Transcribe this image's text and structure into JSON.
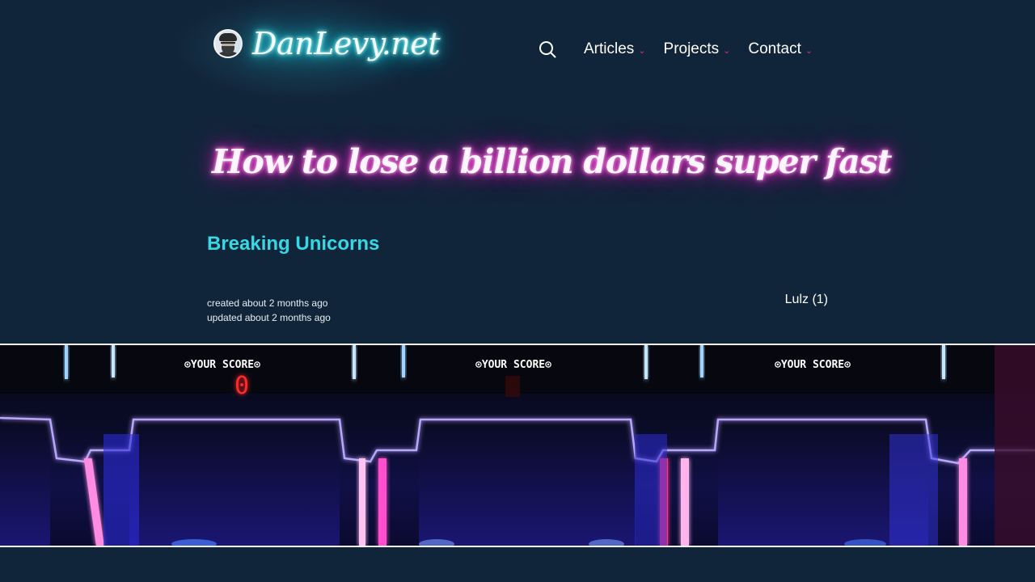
{
  "site": {
    "name": "DanLevy.net"
  },
  "nav": {
    "items": [
      {
        "label": "Articles"
      },
      {
        "label": "Projects"
      },
      {
        "label": "Contact"
      }
    ],
    "chevron": "⌄"
  },
  "article": {
    "title": "How to lose a billion dollars super fast",
    "subtitle": "Breaking Unicorns",
    "created": "created about 2 months ago",
    "updated": "updated about 2 months ago",
    "tag": "Lulz (1)"
  },
  "hero": {
    "scores": [
      {
        "label": "YOUR SCORE",
        "value": "0"
      },
      {
        "label": "YOUR SCORE",
        "value": ""
      },
      {
        "label": "YOUR SCORE",
        "value": ""
      }
    ]
  },
  "colors": {
    "background": "#11253a",
    "accent_cyan": "#35d8e4",
    "accent_pink": "#d42aa8"
  }
}
